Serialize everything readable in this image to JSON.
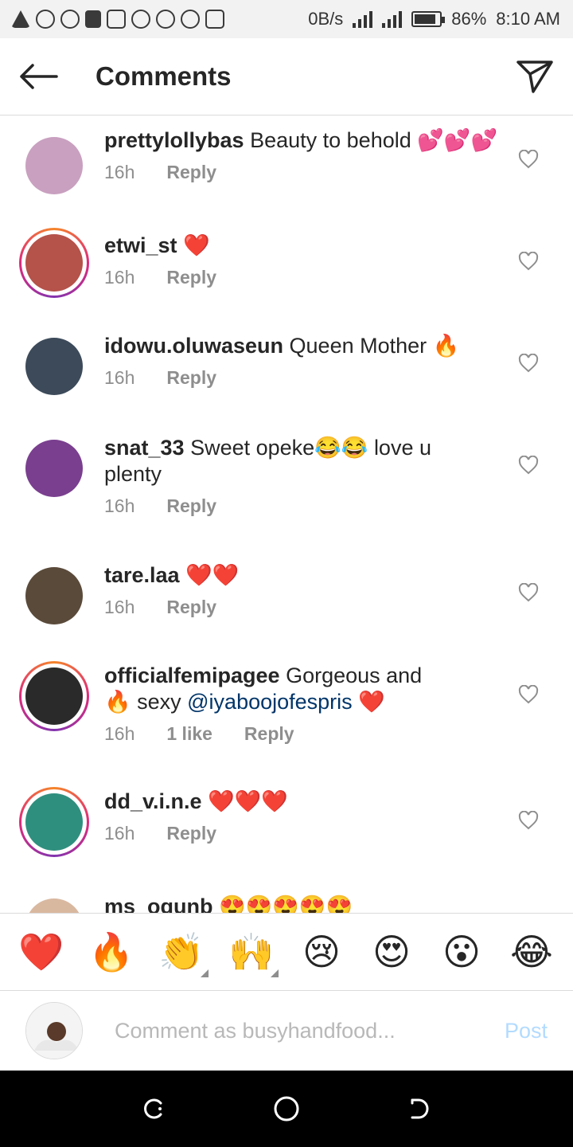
{
  "status_bar": {
    "speed": "0B/s",
    "battery": "86%",
    "time": "8:10 AM",
    "battery_level": 0.86
  },
  "header": {
    "title": "Comments"
  },
  "comments": [
    {
      "username": "prettylollybas",
      "text": "Beauty to behold 💕💕💕",
      "time": "16h",
      "reply": "Reply",
      "avatar_color": "#c9a0c0"
    },
    {
      "username": "etwi_st",
      "text": "❤️",
      "time": "16h",
      "reply": "Reply",
      "avatar_color": "#b5524a"
    },
    {
      "username": "idowu.oluwaseun",
      "text": "Queen Mother 🔥",
      "time": "16h",
      "reply": "Reply",
      "avatar_color": "#3c4a5a"
    },
    {
      "username": "snat_33",
      "text": "Sweet opeke😂😂 love u plenty",
      "time": "16h",
      "reply": "Reply",
      "avatar_color": "#7a3f8f"
    },
    {
      "username": "tare.laa",
      "text": "❤️❤️",
      "time": "16h",
      "reply": "Reply",
      "avatar_color": "#5a4a3a"
    },
    {
      "username": "officialfemipagee",
      "text_before": "Gorgeous and 🔥 sexy ",
      "mention": "@iyaboojofespris",
      "text_after": " ❤️",
      "time": "16h",
      "likes": "1 like",
      "reply": "Reply",
      "avatar_color": "#2a2a2a"
    },
    {
      "username": "dd_v.i.n.e",
      "text": "❤️❤️❤️",
      "time": "16h",
      "reply": "Reply",
      "avatar_color": "#2f8f7f"
    },
    {
      "username": "ms_ogunb",
      "text": "😍😍😍😍😍",
      "avatar_color": "#d9b8a0"
    }
  ],
  "emoji_bar": [
    "❤️",
    "🔥",
    "👏",
    "🙌",
    "😢",
    "😍",
    "😮",
    "😂"
  ],
  "composer": {
    "placeholder": "Comment as busyhandfood...",
    "post_label": "Post"
  }
}
